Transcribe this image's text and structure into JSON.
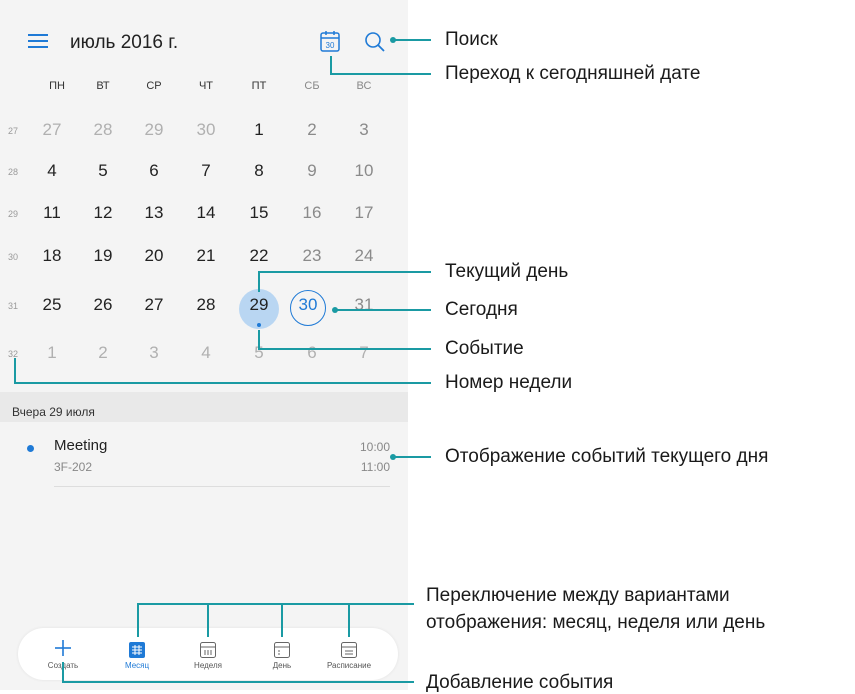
{
  "header": {
    "title": "июль 2016 г.",
    "today_icon_text": "30"
  },
  "weekdays": [
    "ПН",
    "ВТ",
    "СР",
    "ЧТ",
    "ПТ",
    "СБ",
    "ВС"
  ],
  "weeks": [
    {
      "num": "27",
      "days": [
        "27",
        "28",
        "29",
        "30",
        "1",
        "2",
        "3"
      ]
    },
    {
      "num": "28",
      "days": [
        "4",
        "5",
        "6",
        "7",
        "8",
        "9",
        "10"
      ]
    },
    {
      "num": "29",
      "days": [
        "11",
        "12",
        "13",
        "14",
        "15",
        "16",
        "17"
      ]
    },
    {
      "num": "30",
      "days": [
        "18",
        "19",
        "20",
        "21",
        "22",
        "23",
        "24"
      ]
    },
    {
      "num": "31",
      "days": [
        "25",
        "26",
        "27",
        "28",
        "29",
        "30",
        "31"
      ]
    },
    {
      "num": "32",
      "days": [
        "1",
        "2",
        "3",
        "4",
        "5",
        "6",
        "7"
      ]
    }
  ],
  "events_section": {
    "date_label": "Вчера 29 июля",
    "events": [
      {
        "title": "Meeting",
        "location": "3F-202",
        "start": "10:00",
        "end": "11:00"
      }
    ]
  },
  "bottom_bar": {
    "tabs": [
      {
        "label": "Создать",
        "icon": "plus-icon"
      },
      {
        "label": "Месяц",
        "icon": "month-grid-icon"
      },
      {
        "label": "Неделя",
        "icon": "week-icon"
      },
      {
        "label": "День",
        "icon": "day-icon"
      },
      {
        "label": "Расписание",
        "icon": "agenda-icon"
      }
    ]
  },
  "callouts": {
    "search": "Поиск",
    "goto_today": "Переход к сегодняшней дате",
    "current_day": "Текущий день",
    "today": "Сегодня",
    "event": "Событие",
    "week_number": "Номер недели",
    "events_display": "Отображение событий текущего дня",
    "view_switch_line1": "Переключение между вариантами",
    "view_switch_line2": "отображения: месяц, неделя или день",
    "add_event": "Добавление события"
  },
  "colors": {
    "accent": "#1f7ad6",
    "callout": "#1a9aa3",
    "selected_day_bg": "#b9d6f2"
  }
}
